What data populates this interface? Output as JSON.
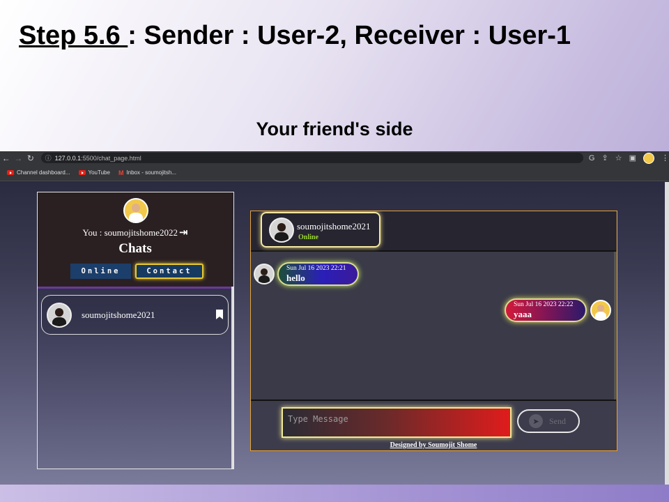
{
  "slide": {
    "title_step": "Step 5.6 ",
    "title_rest": ":  Sender : User-2,  Receiver : User-1",
    "subtitle": "Your friend's side"
  },
  "browser": {
    "url_host": "127.0.0.1",
    "url_path": ":5500/chat_page.html",
    "bookmarks": [
      {
        "label": "Channel dashboard...",
        "icon": "youtube-icon"
      },
      {
        "label": "YouTube",
        "icon": "youtube-icon"
      },
      {
        "label": "Inbox - soumojitsh...",
        "icon": "gmail-icon"
      }
    ],
    "icons": [
      "back-icon",
      "forward-icon",
      "reload-icon",
      "info-icon",
      "google-icon",
      "share-icon",
      "star-icon",
      "sidepanel-icon",
      "profile-avatar",
      "menu-icon"
    ]
  },
  "sidebar": {
    "you_label": "You : soumojitshome2022",
    "chats_title": "Chats",
    "tab_online": "Online",
    "tab_contact": "Contact",
    "contact_name": "soumojitshome2021"
  },
  "chat": {
    "peer_name": "soumojitshome2021",
    "peer_status": "Online",
    "messages": [
      {
        "direction": "incoming",
        "timestamp": "Sun Jul 16 2023 22:21",
        "text": "hello"
      },
      {
        "direction": "outgoing",
        "timestamp": "Sun Jul 16 2023 22:22",
        "text": "yaaa"
      }
    ],
    "input_placeholder": "Type Message",
    "send_label": "Send",
    "credit": "Designed by Soumojit Shome"
  },
  "colors": {
    "accent_gold": "#e7a53a",
    "online_green": "#9bd832",
    "tab_blue": "#1c3e6a"
  }
}
